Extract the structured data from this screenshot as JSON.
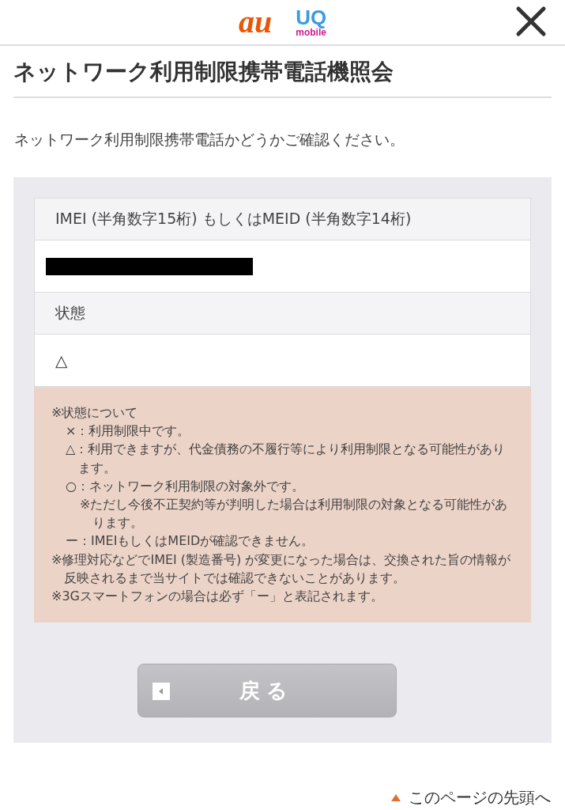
{
  "header": {
    "logos": [
      {
        "kind": "au",
        "text": "au"
      },
      {
        "kind": "uq",
        "text": "UQ",
        "sub": "mobile"
      }
    ]
  },
  "title": "ネットワーク利用制限携帯電話機照会",
  "description": "ネットワーク利用制限携帯電話かどうかご確認ください。",
  "result_table": [
    {
      "label": "IMEI (半角数字15桁) もしくはMEID (半角数字14桁)",
      "value_redacted": true
    },
    {
      "label": "状態",
      "value": "△",
      "value_redacted": false
    }
  ],
  "notes": [
    {
      "text": "※状態について",
      "children": [
        {
          "text": "×：利用制限中です。"
        },
        {
          "text": "△：利用できますが、代金債務の不履行等により利用制限となる可能性があります。"
        },
        {
          "text": "○：ネットワーク利用制限の対象外です。",
          "children": [
            {
              "text": "※ただし今後不正契約等が判明した場合は利用制限の対象となる可能性があります。"
            }
          ]
        },
        {
          "text": "ー：IMEIもしくはMEIDが確認できません。"
        }
      ]
    },
    {
      "text": "※修理対応などでIMEI (製造番号) が変更になった場合は、交換された旨の情報が反映されるまで当サイトでは確認できないことがあります。"
    },
    {
      "text": "※3Gスマートフォンの場合は必ず「ー」と表記されます。"
    }
  ],
  "back_button": {
    "label": "戻る",
    "disabled": true
  },
  "page_top_link": "このページの先頭へ"
}
